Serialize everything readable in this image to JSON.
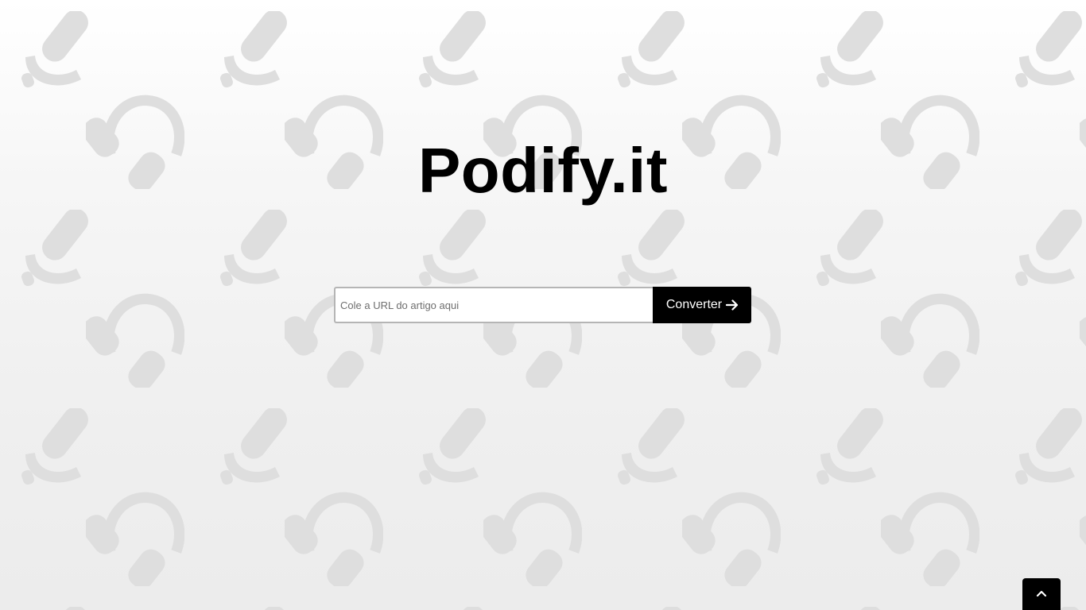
{
  "brand": {
    "title": "Podify.it"
  },
  "form": {
    "url_placeholder": "Cole a URL do artigo aqui",
    "url_value": "",
    "convert_label": "Converter",
    "convert_icon": "arrow-right-icon"
  },
  "scroll_top": {
    "icon": "chevron-up-icon"
  },
  "background": {
    "pattern_icons": [
      "microphone-icon",
      "headphones-icon"
    ],
    "pattern_color": "#dcdcdc"
  },
  "colors": {
    "button_bg": "#000000",
    "button_text": "#ffffff",
    "title_text": "#000000",
    "input_border": "#b5b5b5"
  }
}
